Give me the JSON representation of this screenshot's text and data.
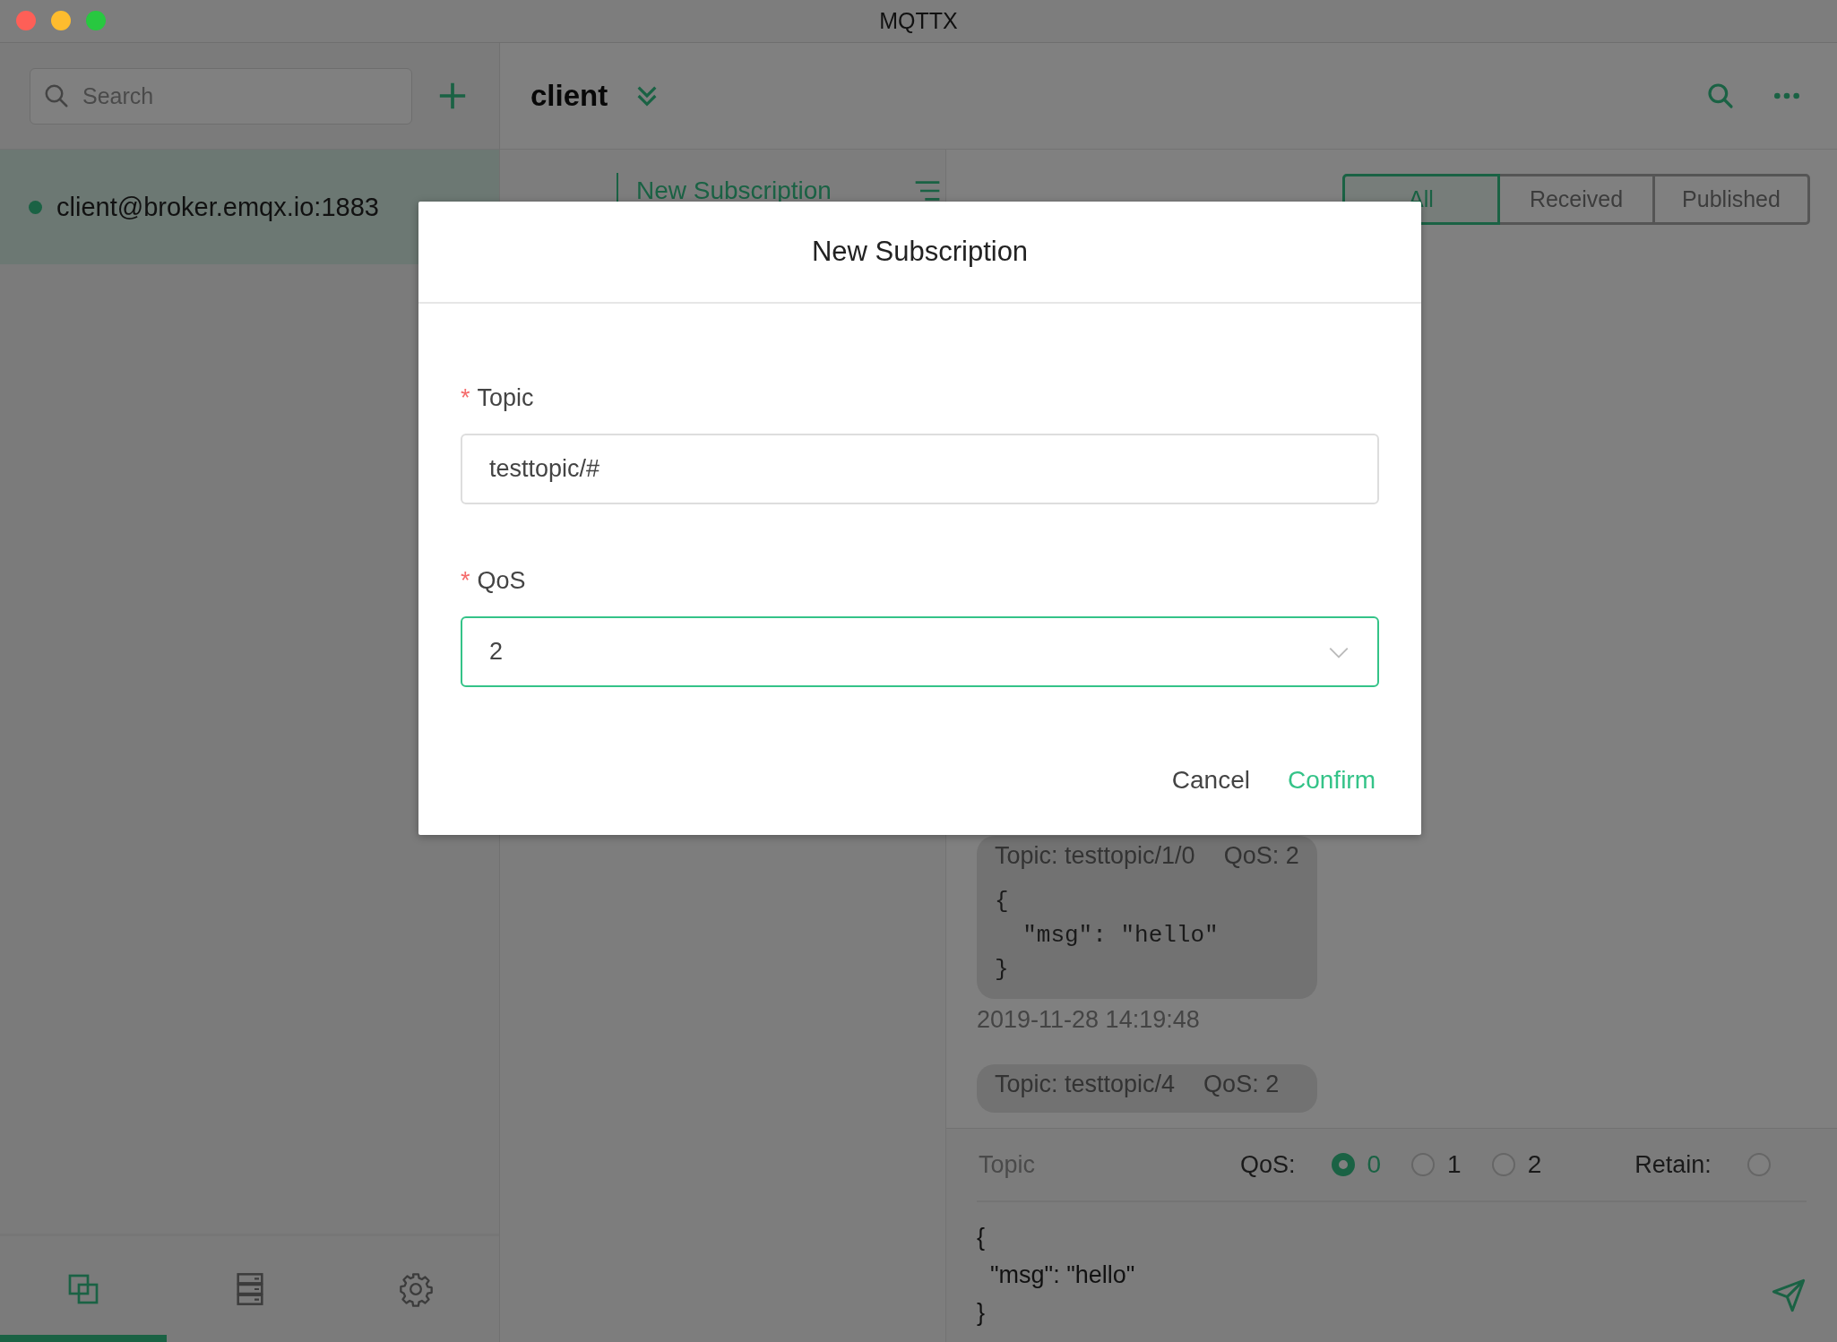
{
  "window": {
    "title": "MQTTX"
  },
  "sidebar": {
    "search": {
      "placeholder": "Search"
    },
    "connections": [
      {
        "name": "client@broker.emqx.io:1883",
        "selected": true,
        "color": "#1a6244"
      }
    ],
    "nav": [
      {
        "kind": "connections",
        "selected": true
      },
      {
        "kind": "scripts",
        "selected": false
      },
      {
        "kind": "settings",
        "selected": false
      }
    ]
  },
  "header": {
    "title": "client"
  },
  "subscriptions": {
    "new_button": "New Subscription"
  },
  "messages": {
    "filters": [
      {
        "label": "All",
        "selected": true
      },
      {
        "label": "Received",
        "selected": false
      },
      {
        "label": "Published",
        "selected": false
      }
    ],
    "items": [
      {
        "topic": "Topic: testtopic/1/0",
        "qos": "QoS: 2",
        "payload": "{\n  \"msg\": \"hello\"\n}",
        "time": "2019-11-28 14:19:48"
      },
      {
        "topic": "Topic: testtopic/4",
        "qos": "QoS: 2"
      }
    ]
  },
  "publish": {
    "topic_placeholder": "Topic",
    "qos_label": "QoS:",
    "qos_options": [
      {
        "label": "0",
        "selected": true
      },
      {
        "label": "1",
        "selected": false
      },
      {
        "label": "2",
        "selected": false
      }
    ],
    "retain_label": "Retain:",
    "retain": false,
    "payload": "{\n  \"msg\": \"hello\"\n}"
  },
  "dialog": {
    "title": "New Subscription",
    "fields": [
      {
        "label": "Topic",
        "mark": "*",
        "kind": "input",
        "value": "testtopic/#",
        "focused": false
      },
      {
        "label": "QoS",
        "mark": "*",
        "kind": "select",
        "value": "2",
        "focused": true
      }
    ],
    "buttons": [
      {
        "label": "Cancel",
        "kind": "default"
      },
      {
        "label": "Confirm",
        "kind": "primary"
      }
    ]
  }
}
